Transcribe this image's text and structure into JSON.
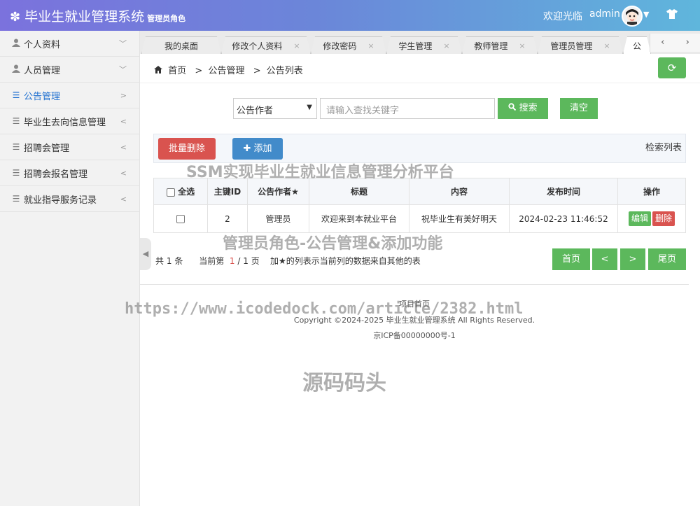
{
  "header": {
    "title": "毕业生就业管理系统",
    "role": "管理员角色",
    "welcome": "欢迎光临",
    "username": "admin"
  },
  "sidebar": {
    "items": [
      {
        "label": "个人资料",
        "icon": "user-icon",
        "arrow": "﹀"
      },
      {
        "label": "人员管理",
        "icon": "user-icon",
        "arrow": "﹀"
      },
      {
        "label": "公告管理",
        "icon": "menu-icon",
        "arrow": ">"
      },
      {
        "label": "毕业生去向信息管理",
        "icon": "menu-icon",
        "arrow": "<"
      },
      {
        "label": "招聘会管理",
        "icon": "menu-icon",
        "arrow": "<"
      },
      {
        "label": "招聘会报名管理",
        "icon": "menu-icon",
        "arrow": "<"
      },
      {
        "label": "就业指导服务记录",
        "icon": "menu-icon",
        "arrow": "<"
      }
    ]
  },
  "tabs": [
    {
      "label": "我的桌面"
    },
    {
      "label": "修改个人资料"
    },
    {
      "label": "修改密码"
    },
    {
      "label": "学生管理"
    },
    {
      "label": "教师管理"
    },
    {
      "label": "管理员管理"
    },
    {
      "label": "公"
    }
  ],
  "breadcrumb": {
    "home": "首页",
    "level1": "公告管理",
    "level2": "公告列表"
  },
  "search": {
    "select_value": "公告作者",
    "placeholder": "请输入查找关键字",
    "search_label": "搜索",
    "clear_label": "清空"
  },
  "toolbar": {
    "batch_delete": "批量删除",
    "add": "添加",
    "list_label": "检索列表"
  },
  "watermarks": {
    "line1": "SSM实现毕业生就业信息管理分析平台",
    "line2": "管理员角色-公告管理&添加功能",
    "line3": "https://www.icodedock.com/article/2382.html",
    "line4": "源码码头"
  },
  "table": {
    "headers": [
      "全选",
      "主键ID",
      "公告作者★",
      "标题",
      "内容",
      "发布时间",
      "操作"
    ],
    "rows": [
      {
        "id": "2",
        "author": "管理员",
        "title": "欢迎来到本就业平台",
        "content": "祝毕业生有美好明天",
        "time": "2024-02-23 11:46:52",
        "edit": "编辑",
        "delete": "删除"
      }
    ]
  },
  "pager": {
    "total_prefix": "共",
    "total": "1",
    "total_suffix": "条",
    "current_prefix": "当前第",
    "current": "1",
    "sep": "/",
    "pages": "1",
    "pages_suffix": "页",
    "note": "加★的列表示当前列的数据来自其他的表",
    "first": "首页",
    "prev": "<",
    "next": ">",
    "last": "尾页"
  },
  "footer": {
    "link": "项目首页",
    "copyright": "Copyright ©2024-2025 毕业生就业管理系统 All Rights Reserved.",
    "icp": "京ICP备00000000号-1"
  },
  "colors": {
    "green": "#5cb85c",
    "red": "#d9534f",
    "blue": "#428bca"
  }
}
